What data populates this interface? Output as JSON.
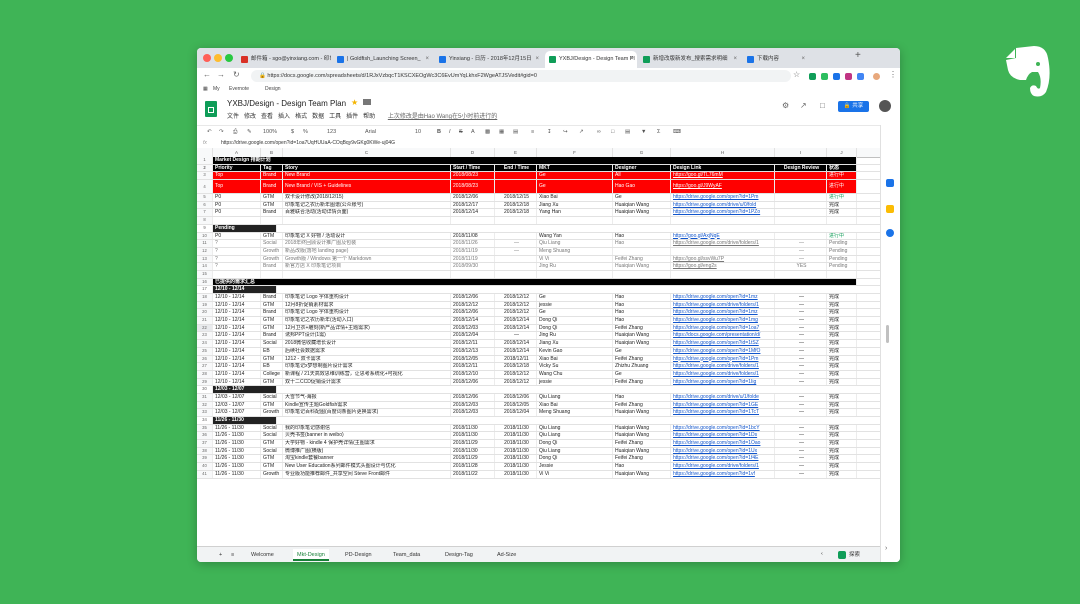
{
  "browser": {
    "tabs": [
      {
        "label": "邮件箱 - sgo@yinxiang.com - 印象",
        "color": "#d93025"
      },
      {
        "label": "| Goldfish_Launching Screen_",
        "color": "#1a73e8"
      },
      {
        "label": "Yinxiang - 日历 - 2018年12月15日",
        "color": "#1a73e8"
      },
      {
        "label": "YXBJ/Design - Design Team Pl",
        "color": "#0f9d58"
      },
      {
        "label": "新增改版新发布_搜索需求明细",
        "color": "#0f9d58"
      },
      {
        "label": "下载内容",
        "color": "#1a73e8"
      }
    ],
    "url": "https://docs.google.com/spreadsheets/d/1RJxVzbqcT1KSCXEOgWc3C6EvUmYqLkhxF2WgeATJSVedit#gid=0",
    "bookmarks": [
      "My",
      "Evernote",
      "Design"
    ]
  },
  "doc": {
    "title": "YXBJ/Design - Design Team Plan",
    "menu": [
      "文件",
      "修改",
      "查看",
      "插入",
      "格式",
      "数据",
      "工具",
      "插件",
      "帮助"
    ],
    "last_edit": "上次修改是由Hao Wang在5小时前进行的",
    "share_label": "共享"
  },
  "toolbar": {
    "zoom": "100%",
    "currency": "$",
    "percent": "%",
    "format": "123",
    "font": "Arial",
    "size": "10"
  },
  "formula": {
    "fx": "fx",
    "value": "https://drive.google.com/open?id=1oa7UqHUUaA-COqBqy9vGKg0KWe-uj04G"
  },
  "columns": [
    "A",
    "B",
    "C",
    "D",
    "E",
    "F",
    "G",
    "H",
    "I",
    "J"
  ],
  "rows": [
    {
      "n": "1",
      "style": "black",
      "span": "Market Design 排期计划"
    },
    {
      "n": "2",
      "style": "black hdr",
      "c": [
        "Priority",
        "Tag",
        "Story",
        "Start / Time",
        "End / Time",
        "MKT",
        "Designer",
        "Design Link",
        "Design Review",
        "状态"
      ]
    },
    {
      "n": "3",
      "style": "red",
      "c": [
        "Top",
        "Brand",
        "New Brand",
        "2018/08/23",
        "",
        "Ge",
        "All",
        "https://goo.gl/TL76mM",
        "",
        "进行中"
      ]
    },
    {
      "n": "4",
      "style": "red tall",
      "c": [
        "Top",
        "Brand",
        "New Brand / VIS + Guidelines",
        "2018/08/23",
        "",
        "Ge",
        "Hao Gao",
        "https://goo.gl/J9WyAF",
        "",
        "进行中"
      ]
    },
    {
      "n": "5",
      "style": "",
      "c": [
        "P0",
        "GTM",
        "双卡设计修改(2018/12/15)",
        "2018/12/06",
        "2018/12/15",
        "Xiao Bai",
        "Ge",
        "https://drive.google.com/open?id=1Pm",
        "",
        "进行中"
      ],
      "lastGreen": true
    },
    {
      "n": "6",
      "style": "",
      "c": [
        "P0",
        "GTM",
        "印象笔记之农历新年图谱(公众账号)",
        "2018/12/17",
        "2018/12/18",
        "Jiang Xu",
        "Huaiqian Wang",
        "https://drive.google.com/drive/u/0/fold",
        "",
        "完成"
      ]
    },
    {
      "n": "7",
      "style": "",
      "c": [
        "P0",
        "Brand",
        "百雅联合活动(活动详情页面)",
        "2018/12/14",
        "2018/12/18",
        "Yang Han",
        "Huaiqian Wang",
        "https://drive.google.com/open?id=1PZo",
        "",
        "完成"
      ]
    },
    {
      "n": "8",
      "style": "",
      "c": [
        "",
        "",
        "",
        "",
        "",
        "",
        "",
        "",
        "",
        ""
      ]
    },
    {
      "n": "9",
      "style": "sub",
      "sub": "Pending"
    },
    {
      "n": "10",
      "style": "",
      "c": [
        "P0",
        "GTM",
        "印象笔记 X 好物 / 活动设计",
        "2018/11/08",
        "",
        "Wang Yan",
        "Hao",
        "https://goo.gl/AxjNqE",
        "",
        "进行中"
      ],
      "lastGreen": true
    },
    {
      "n": "11",
      "style": "gray",
      "c": [
        "?",
        "Social",
        "2018年终回顾设计推广图及包装",
        "2018/11/26",
        "—",
        "Qiu Liang",
        "Hao",
        "https://drive.google.com/drive/folders/1",
        "—",
        "Pending"
      ]
    },
    {
      "n": "12",
      "style": "gray",
      "c": [
        "?",
        "Growth",
        "新品改版(落地 landing page)",
        "2018/11/19",
        "—",
        "Meng Shuang",
        "",
        "",
        "—",
        "Pending"
      ]
    },
    {
      "n": "13",
      "style": "gray",
      "c": [
        "?",
        "Growth",
        "Growth版 / Windows 第一个 Markdown",
        "2018/11/19",
        "",
        "Vi Vi",
        "Feifei Zhang",
        "https://goo.gl/ssvWu7P",
        "—",
        "Pending"
      ]
    },
    {
      "n": "14",
      "style": "gray",
      "c": [
        "?",
        "Brand",
        "新官方店 X 印象笔记项目",
        "2018/09/30",
        "",
        "Jing Ru",
        "Huaiqian Wang",
        "https://goo.gl/eng2s",
        "YES",
        "Pending"
      ]
    },
    {
      "n": "15",
      "style": "",
      "c": [
        "",
        "",
        "",
        "",
        "",
        "",
        "",
        "",
        "",
        ""
      ]
    },
    {
      "n": "16",
      "style": "black",
      "span": "已提供的需求汇总"
    },
    {
      "n": "17",
      "style": "sub",
      "sub": "12/10 - 12/14"
    },
    {
      "n": "18",
      "style": "",
      "c": [
        "12/10 - 12/14",
        "Brand",
        "印象笔记 Logo 字体重构设计",
        "2018/12/06",
        "2018/12/12",
        "Ge",
        "Hao",
        "https://drive.google.com/open?id=1mz",
        "—",
        "完成"
      ]
    },
    {
      "n": "19",
      "style": "",
      "c": [
        "12/10 - 12/14",
        "GTM",
        "12月8折促销素材需求",
        "2018/12/12",
        "2018/12/12",
        "jessie",
        "Hao",
        "https://drive.google.com/drive/folders/1",
        "—",
        "完成"
      ]
    },
    {
      "n": "20",
      "style": "",
      "c": [
        "12/10 - 12/14",
        "Brand",
        "印象笔记 Logo 字体重构设计",
        "2018/12/06",
        "2018/12/12",
        "Ge",
        "Hao",
        "https://drive.google.com/open?id=1mz",
        "—",
        "完成"
      ]
    },
    {
      "n": "21",
      "style": "",
      "c": [
        "12/10 - 12/14",
        "GTM",
        "印象笔记之农历新年(活动入口)",
        "2018/12/14",
        "2018/12/14",
        "Dong Qi",
        "Hao",
        "https://drive.google.com/open?id=1mg",
        "—",
        "完成"
      ]
    },
    {
      "n": "22",
      "style": "sel",
      "c": [
        "12/10 - 12/14",
        "GTM",
        "12月卫衣+雕刻(新产品详情+主题需求)",
        "2018/12/03",
        "2018/12/14",
        "Dong Qi",
        "Feifei Zhang",
        "https://drive.google.com/open?id=1oa7",
        "—",
        "完成"
      ]
    },
    {
      "n": "23",
      "style": "",
      "c": [
        "12/10 - 12/14",
        "Brand",
        "诱邦PPT设计(1需)",
        "2018/12/04",
        "—",
        "Jing Ru",
        "Huaiqian Wang",
        "https://docs.google.com/presentation/d/",
        "—",
        "完成"
      ]
    },
    {
      "n": "24",
      "style": "",
      "c": [
        "12/10 - 12/14",
        "Social",
        "2018微信收藏增长设计",
        "2018/12/11",
        "2018/12/14",
        "Jiang Xu",
        "Huaiqian Wang",
        "https://drive.google.com/open?id=1tSZ",
        "—",
        "完成"
      ]
    },
    {
      "n": "25",
      "style": "",
      "c": [
        "12/10 - 12/14",
        "EB",
        "后续社会数据需求",
        "2018/12/13",
        "2018/12/14",
        "Kevin Gao",
        "Ge",
        "https://drive.google.com/open?id=1MfO",
        "—",
        "完成"
      ]
    },
    {
      "n": "26",
      "style": "",
      "c": [
        "12/10 - 12/14",
        "GTM",
        "1212 - 双卡需求",
        "2018/12/05",
        "2018/12/11",
        "Xiao Bai",
        "Feifei Zhang",
        "https://drive.google.com/open?id=1Pm",
        "—",
        "完成"
      ]
    },
    {
      "n": "27",
      "style": "",
      "c": [
        "12/10 - 12/14",
        "EB",
        "印象笔记x梦想制图片设计需求",
        "2018/12/11",
        "2018/12/18",
        "Vicky Su",
        "Zhizhu Zhuang",
        "https://drive.google.com/drive/folders/1",
        "—",
        "完成"
      ]
    },
    {
      "n": "28",
      "style": "",
      "c": [
        "12/10 - 12/14",
        "College",
        "新课程 / 21天高效思维训练营，让思考系统化+可视化",
        "2018/12/10",
        "2018/12/12",
        "Wang Chu",
        "Ge",
        "https://drive.google.com/drive/folders/1",
        "—",
        "完成"
      ]
    },
    {
      "n": "29",
      "style": "",
      "c": [
        "12/10 - 12/14",
        "GTM",
        "双十二CCD促销设计需求",
        "2018/12/06",
        "2018/12/12",
        "jessie",
        "Feifei Zhang",
        "https://drive.google.com/open?id=1Iig",
        "—",
        "完成"
      ]
    },
    {
      "n": "30",
      "style": "sub",
      "sub": "12/03 - 12/07"
    },
    {
      "n": "31",
      "style": "",
      "c": [
        "12/03 - 12/07",
        "Social",
        "大雪节气-海报",
        "2018/12/06",
        "2018/12/06",
        "Qiu Liang",
        "Hao",
        "https://drive.google.com/drive/u/1/folde",
        "—",
        "完成"
      ]
    },
    {
      "n": "32",
      "style": "",
      "c": [
        "12/03 - 12/07",
        "GTM",
        "Kindle宣传主题Goldfish需求",
        "2018/12/03",
        "2018/12/05",
        "Xiao Bai",
        "Feifei Zhang",
        "https://drive.google.com/open?id=1GE",
        "—",
        "完成"
      ]
    },
    {
      "n": "33",
      "style": "",
      "c": [
        "12/03 - 12/07",
        "Growth",
        "印象笔记百科配图(百度词条图片更换需求)",
        "2018/12/03",
        "2018/12/04",
        "Meng Shuang",
        "Huaiqian Wang",
        "https://drive.google.com/open?id=1TcT",
        "—",
        "完成"
      ]
    },
    {
      "n": "34",
      "style": "sub",
      "sub": "11/26 - 11/30"
    },
    {
      "n": "35",
      "style": "",
      "c": [
        "11/26 - 11/30",
        "Social",
        "我的印象笔记感谢信",
        "2018/11/30",
        "2018/11/30",
        "Qiu Liang",
        "Huaiqian Wang",
        "https://drive.google.com/open?id=1bcY",
        "—",
        "完成"
      ]
    },
    {
      "n": "36",
      "style": "",
      "c": [
        "11/26 - 11/30",
        "Social",
        "贝壳书签(banner in weibo)",
        "2018/11/30",
        "2018/11/30",
        "Qiu Liang",
        "Huaiqian Wang",
        "https://drive.google.com/open?id=1Ds",
        "—",
        "完成"
      ]
    },
    {
      "n": "37",
      "style": "",
      "c": [
        "11/26 - 11/30",
        "GTM",
        "大学好物 - kindle 4 保护壳详情(主图需求",
        "2018/11/29",
        "2018/11/30",
        "Dong Qi",
        "Feifei Zhang",
        "https://drive.google.com/open?id=1Oao",
        "—",
        "完成"
      ]
    },
    {
      "n": "38",
      "style": "",
      "c": [
        "11/26 - 11/30",
        "Social",
        "微博推广图(横版)",
        "2018/11/30",
        "2018/11/30",
        "Qiu Liang",
        "Huaiqian Wang",
        "https://drive.google.com/open?id=1Ux",
        "—",
        "完成"
      ]
    },
    {
      "n": "39",
      "style": "",
      "c": [
        "11/26 - 11/30",
        "GTM",
        "淘宝kindle套餐banner",
        "2018/11/29",
        "2018/11/30",
        "Dong Qi",
        "Feifei Zhang",
        "https://drive.google.com/open?id=1f4E",
        "—",
        "完成"
      ]
    },
    {
      "n": "40",
      "style": "",
      "c": [
        "11/26 - 11/30",
        "GTM",
        "New User Education系列邮件模式头图设计与优化",
        "2018/11/28",
        "2018/11/30",
        "Jessie",
        "Hao",
        "https://drive.google.com/drive/folders/1",
        "—",
        "完成"
      ]
    },
    {
      "n": "41",
      "style": "",
      "c": [
        "11/26 - 11/30",
        "Growth",
        "专业版功能推荐邮件_共享空间 Steve Front邮件",
        "2018/11/22",
        "2018/11/30",
        "Vi Vi",
        "Huaiqian Wang",
        "https://drive.google.com/open?id=1vf",
        "—",
        "完成"
      ]
    }
  ],
  "sheet_tabs": [
    "Welcome",
    "Mkt-Design",
    "PD-Design",
    "Team_data",
    "Design-Tag",
    "Ad-Size"
  ],
  "explore_label": "探索",
  "icons": {
    "brand": "evernote-elephant-icon",
    "accent": "#0f9d58"
  }
}
